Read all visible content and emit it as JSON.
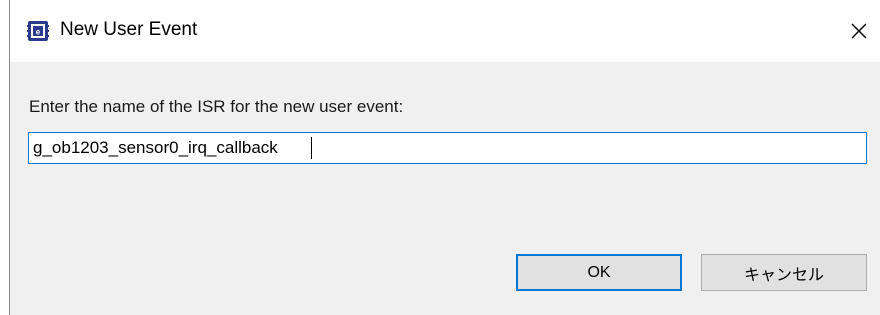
{
  "window": {
    "title": "New User Event",
    "icon": "app-chip-icon",
    "close_icon": "close-icon"
  },
  "form": {
    "prompt": "Enter the name of the ISR for the new user event:",
    "isr_name_value": "g_ob1203_sensor0_irq_callback"
  },
  "buttons": {
    "ok_label": "OK",
    "cancel_label": "キャンセル"
  },
  "colors": {
    "accent": "#0078d7",
    "dialog_bg": "#f0f0f0",
    "button_bg": "#e1e1e1"
  }
}
